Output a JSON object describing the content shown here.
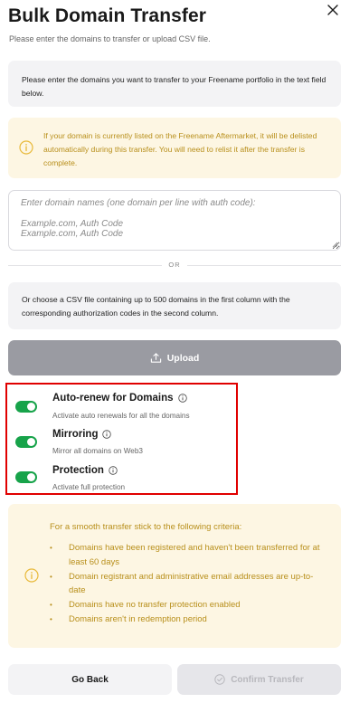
{
  "dialog": {
    "title": "Bulk Domain Transfer",
    "subtitle": "Please enter the domains to transfer or upload CSV file."
  },
  "intro": {
    "text": "Please enter the domains you want to transfer to your Freename portfolio in the text field below."
  },
  "warning": {
    "text": "If your domain is currently listed on the Freename Aftermarket, it will be delisted automatically during this transfer. You will need to relist it after the transfer is complete."
  },
  "domain_input": {
    "label": "Enter domain names (one domain per line with auth code):",
    "placeholder_line1": "Example.com, Auth Code",
    "placeholder_line2": "Example.com, Auth Code",
    "value": ""
  },
  "divider": {
    "text": "OR"
  },
  "csv": {
    "text": "Or choose a CSV file containing up to 500 domains in the first column with the corresponding authorization codes in the second column.",
    "upload_label": "Upload"
  },
  "options": [
    {
      "title": "Auto-renew for Domains",
      "description": "Activate auto renewals for all the domains",
      "enabled": true
    },
    {
      "title": "Mirroring",
      "description": "Mirror all domains on Web3",
      "enabled": true
    },
    {
      "title": "Protection",
      "description": "Activate full protection",
      "enabled": true
    }
  ],
  "criteria": {
    "heading": "For a smooth transfer stick to the following criteria:",
    "items": [
      "Domains have been registered and haven't been transferred for at least 60 days",
      "Domain registrant and administrative email addresses are up-to-date",
      "Domains have no transfer protection enabled",
      "Domains aren't in redemption period"
    ]
  },
  "footer": {
    "back_label": "Go Back",
    "confirm_label": "Confirm Transfer"
  },
  "colors": {
    "toggle_on": "#17a34a",
    "warning_text": "#b88f1b",
    "warning_bg": "#fdf6e3",
    "highlight_border": "#e00000",
    "upload_bg": "#9a9ba2"
  },
  "icons": {
    "close": "close-icon",
    "warning": "info-circle-icon",
    "upload": "upload-icon",
    "option_info": "info-circle-icon",
    "confirm": "check-circle-icon"
  }
}
